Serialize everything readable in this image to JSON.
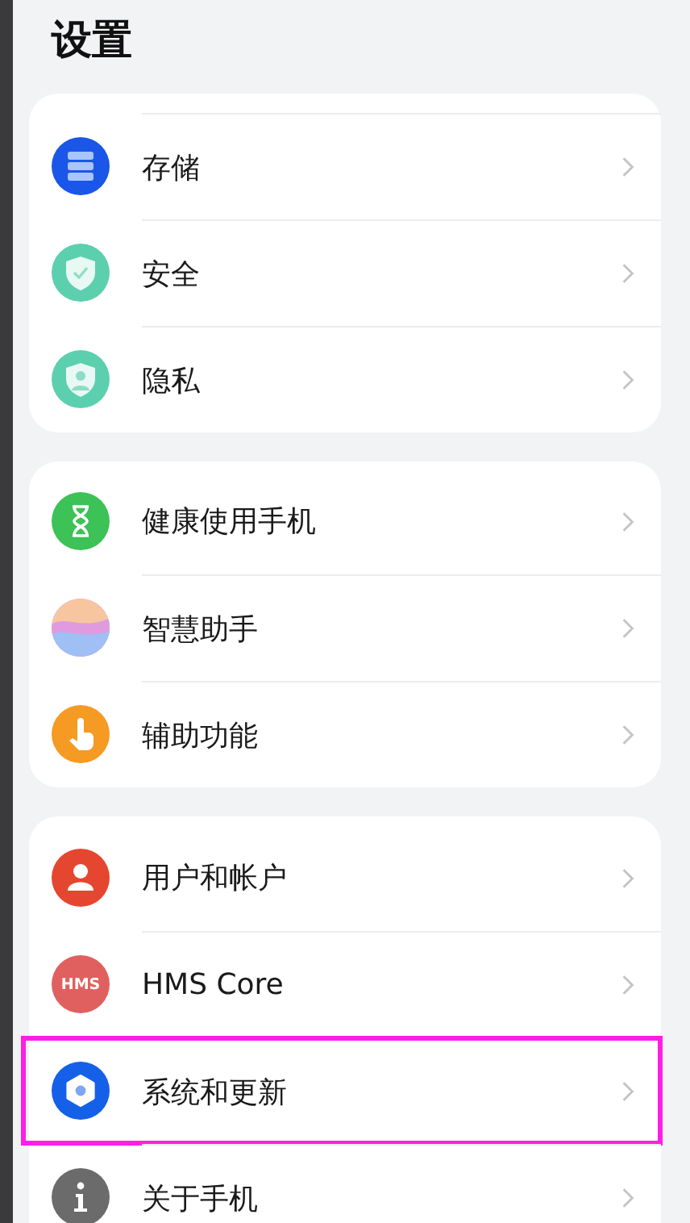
{
  "title": "设置",
  "groups": [
    {
      "items": [
        {
          "label": "存储",
          "kind": "storage",
          "color": "#1a56e8",
          "highlighted": false
        },
        {
          "label": "安全",
          "kind": "security",
          "color": "#5ccfae",
          "highlighted": false
        },
        {
          "label": "隐私",
          "kind": "privacy",
          "color": "#5ccfae",
          "highlighted": false
        }
      ]
    },
    {
      "items": [
        {
          "label": "健康使用手机",
          "kind": "wellbeing",
          "color": "#3cc256",
          "highlighted": false
        },
        {
          "label": "智慧助手",
          "kind": "assistant",
          "color": "#c79ae8",
          "highlighted": false
        },
        {
          "label": "辅助功能",
          "kind": "accessibility",
          "color": "#f59a23",
          "highlighted": false
        }
      ]
    },
    {
      "items": [
        {
          "label": "用户和帐户",
          "kind": "accounts",
          "color": "#e5462f",
          "highlighted": false
        },
        {
          "label": "HMS Core",
          "kind": "hms",
          "icon_text": "HMS",
          "color": "#e06060",
          "highlighted": false
        },
        {
          "label": "系统和更新",
          "kind": "system",
          "color": "#1560e8",
          "highlighted": true
        },
        {
          "label": "关于手机",
          "kind": "about",
          "color": "#6b6b6b",
          "highlighted": false
        }
      ]
    }
  ]
}
